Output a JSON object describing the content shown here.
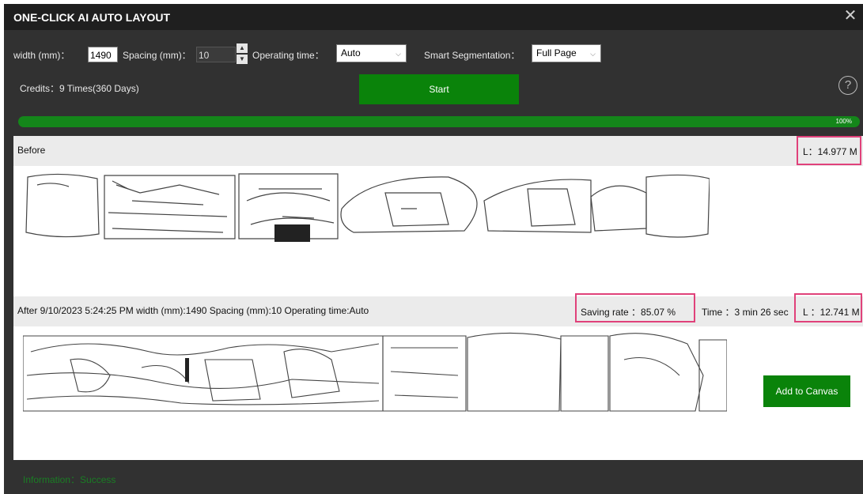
{
  "window": {
    "title": "ONE-CLICK AI AUTO LAYOUT",
    "close_glyph": "✕"
  },
  "controls": {
    "width_label": "width (mm)：",
    "width_value": "1490",
    "spacing_label": "Spacing (mm)：",
    "spacing_value": "10",
    "op_time_label": "Operating time：",
    "op_time_value": "Auto",
    "smart_seg_label": "Smart Segmentation：",
    "smart_seg_value": "Full Page",
    "credits": "Credits：9 Times(360 Days)",
    "start_label": "Start",
    "help_glyph": "?"
  },
  "progress": {
    "value": 1.0,
    "label": "100%",
    "color": "#14861a"
  },
  "before": {
    "label": "Before",
    "length": "L：14.977 M"
  },
  "after": {
    "summary": "After  9/10/2023 5:24:25 PM  width (mm):1490  Spacing (mm):10  Operating time:Auto",
    "saving_rate": "Saving rate ：85.07 %",
    "time": "Time ：3 min 26 sec",
    "length": "L ：12.741 M",
    "add_button": "Add to Canvas"
  },
  "status": {
    "info": "Information：Success"
  },
  "colors": {
    "accent": "#0a830a",
    "highlight": "#e0417a",
    "background": "#313131"
  }
}
